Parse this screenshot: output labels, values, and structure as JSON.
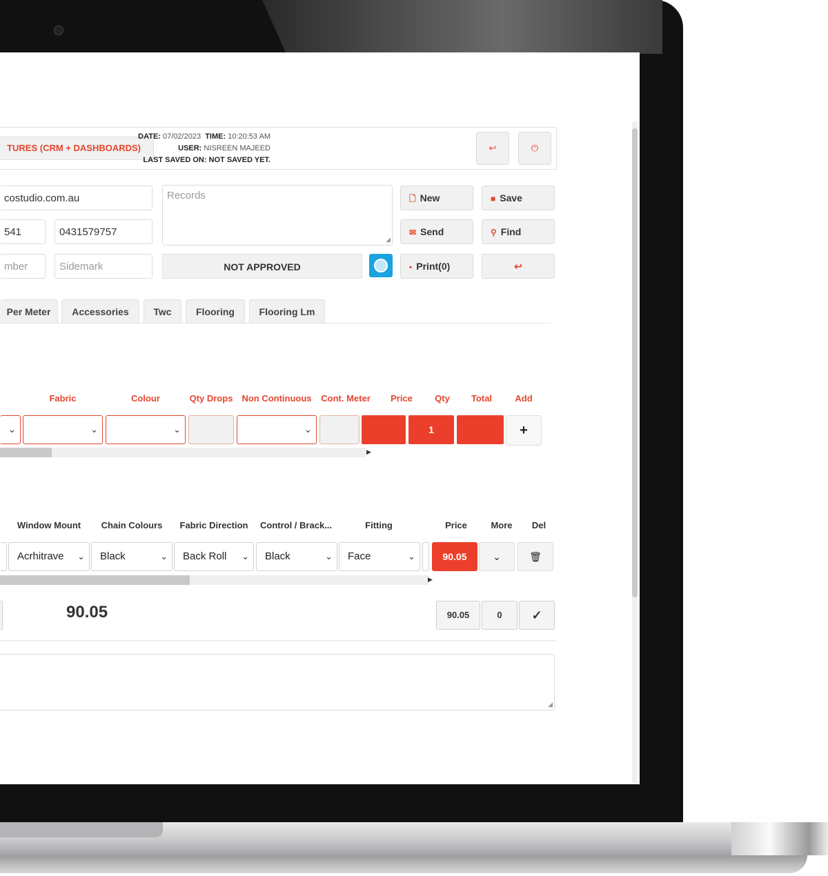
{
  "header": {
    "features_button": "TURES (CRM + DASHBOARDS)",
    "date_label": "DATE:",
    "date_value": "07/02/2023",
    "time_label": "TIME:",
    "time_value": "10:20:53 AM",
    "user_label": "USER:",
    "user_value": "NISREEN MAJEED",
    "saved_label": "LAST SAVED ON:",
    "saved_value": "NOT SAVED YET.",
    "undo_icon": "undo-arrow",
    "power_icon": "power"
  },
  "customer": {
    "email_value": "costudio.com.au",
    "phone1_value": "541",
    "phone2_value": "0431579757",
    "number_placeholder": "mber",
    "sidemark_placeholder": "Sidemark",
    "records_placeholder": "Records",
    "approval_status": "NOT APPROVED"
  },
  "actions": {
    "new": "New",
    "save": "Save",
    "send": "Send",
    "find": "Find",
    "print": "Print(0)"
  },
  "tabs": [
    "Per Meter",
    "Accessories",
    "Twc",
    "Flooring",
    "Flooring Lm"
  ],
  "grid1": {
    "headers": [
      "Fabric",
      "Colour",
      "Qty Drops",
      "Non Continuous",
      "Cont. Meter",
      "Price",
      "Qty",
      "Total",
      "Add"
    ],
    "qty_value": "1",
    "add_symbol": "+"
  },
  "grid2": {
    "headers": [
      "Window Mount",
      "Chain Colours",
      "Fabric Direction",
      "Control / Brack...",
      "Fitting",
      "Price",
      "More",
      "Del"
    ],
    "window_mount": "Acrhitrave",
    "chain_colours": "Black",
    "fabric_direction": "Back Roll",
    "control_bracket": "Black",
    "fitting": "Face",
    "price": "90.05"
  },
  "totals": {
    "grand_total": "90.05",
    "subtotal_button": "90.05",
    "count_button": "0",
    "confirm_symbol": "✓"
  },
  "colors": {
    "accent_red": "#ec3f2b",
    "status_icon_blue": "#1aa3e0"
  }
}
